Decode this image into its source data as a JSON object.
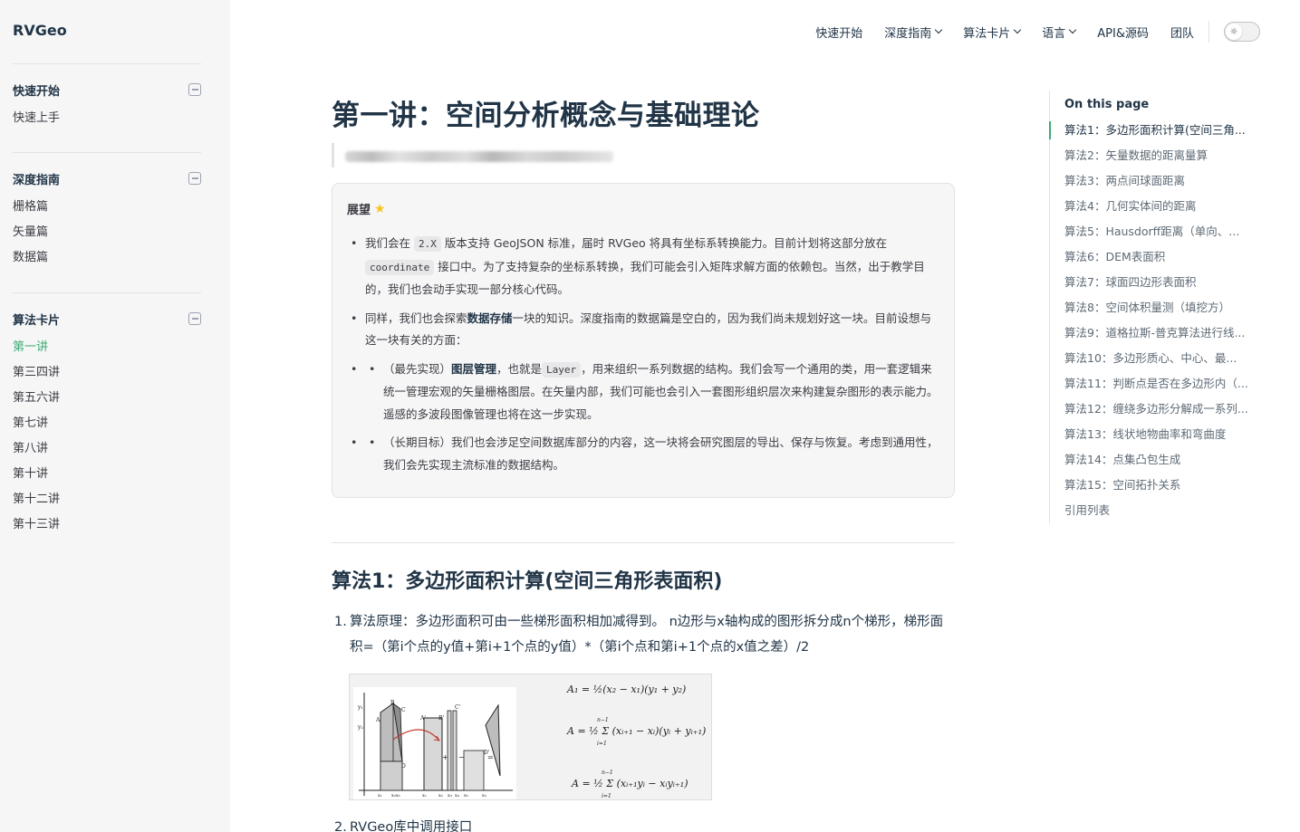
{
  "site": {
    "brand": "RVGeo"
  },
  "nav": {
    "items": [
      {
        "label": "快速开始",
        "dropdown": false
      },
      {
        "label": "深度指南",
        "dropdown": true
      },
      {
        "label": "算法卡片",
        "dropdown": true
      },
      {
        "label": "语言",
        "dropdown": true
      },
      {
        "label": "API&源码",
        "dropdown": false
      },
      {
        "label": "团队",
        "dropdown": false
      }
    ],
    "theme_toggle_icon": "sun-icon"
  },
  "sidebar": {
    "groups": [
      {
        "title": "快速开始",
        "items": [
          "快速上手"
        ]
      },
      {
        "title": "深度指南",
        "items": [
          "栅格篇",
          "矢量篇",
          "数据篇"
        ]
      },
      {
        "title": "算法卡片",
        "items": [
          "第一讲",
          "第三四讲",
          "第五六讲",
          "第七讲",
          "第八讲",
          "第十讲",
          "第十二讲",
          "第十三讲"
        ],
        "active": "第一讲"
      }
    ]
  },
  "page": {
    "title": "第一讲：空间分析概念与基础理论",
    "callout": {
      "title": "展望",
      "icon": "star-icon",
      "items": {
        "i1": {
          "a": "我们会在",
          "code1": "2.X",
          "b": "版本支持 GeoJSON 标准，届时 RVGeo 将具有坐标系转换能力。目前计划将这部分放在",
          "code2": "coordinate",
          "c": "接口中。为了支持复杂的坐标系转换，我们可能会引入矩阵求解方面的依赖包。当然，出于教学目的，我们也会动手实现一部分核心代码。"
        },
        "i2": {
          "a": "同样，我们也会探索",
          "strong": "数据存储",
          "b": "一块的知识。深度指南的数据篇是空白的，因为我们尚未规划好这一块。目前设想与这一块有关的方面："
        },
        "i3": {
          "a": "（最先实现）",
          "strong": "图层管理",
          "b": "，也就是",
          "code": "Layer",
          "c": "，用来组织一系列数据的结构。我们会写一个通用的类，用一套逻辑来统一管理宏观的矢量栅格图层。在矢量内部，我们可能也会引入一套图形组织层次来构建复杂图形的表示能力。遥感的多波段图像管理也将在这一步实现。"
        },
        "i4": {
          "a": "（长期目标）我们也会涉足空间数据库部分的内容，这一块将会研究图层的导出、保存与恢复。考虑到通用性，我们会先实现主流标准的数据结构。"
        }
      }
    },
    "section1": {
      "title": "算法1：多边形面积计算(空间三角形表面积)",
      "steps": [
        {
          "num": "1.",
          "text": "算法原理：多边形面积可由一些梯形面积相加减得到。 n边形与x轴构成的图形拆分成n个梯形，梯形面积=（第i个点的y值+第i+1个点的y值）*（第i个点和第i+1个点的x值之差）/2"
        },
        {
          "num": "2.",
          "text": "RVGeo库中调用接口"
        }
      ],
      "figure": {
        "formula1": "A₁ = ½(x₂ − x₁)(y₁ + y₂)",
        "formula2": "A = ½ Σ (xᵢ₊₁ − xᵢ)(yᵢ + yᵢ₊₁)",
        "formula3": "A = ½ Σ (xᵢ₊₁yᵢ − xᵢyᵢ₊₁)",
        "sum_upper": "n−1",
        "sum_lower": "i=1",
        "labels": [
          "y₁",
          "y₂",
          "A",
          "B",
          "C",
          "A'",
          "B'",
          "C'",
          "D",
          "D'",
          "+",
          "−",
          "=",
          "x₁",
          "x₂x₃",
          "x₁",
          "x₂",
          "x₃",
          "x₄",
          "x₅",
          "x₃"
        ]
      }
    }
  },
  "toc": {
    "title": "On this page",
    "items": [
      "算法1：多边形面积计算(空间三角...",
      "算法2：矢量数据的距离量算",
      "算法3：两点间球面距离",
      "算法4：几何实体间的距离",
      "算法5：Hausdorff距离（单向、...",
      "算法6：DEM表面积",
      "算法7：球面四边形表面积",
      "算法8：空间体积量测（填挖方）",
      "算法9：道格拉斯-普克算法进行线...",
      "算法10：多边形质心、中心、最...",
      "算法11：判断点是否在多边形内（...",
      "算法12：缠绕多边形分解成一系列...",
      "算法13：线状地物曲率和弯曲度",
      "算法14：点集凸包生成",
      "算法15：空间拓扑关系",
      "引用列表"
    ],
    "active_index": 0,
    "marker_color": "#3dab74"
  },
  "colors": {
    "accent": "#3dab74",
    "text": "#213547",
    "muted": "#3c3c43"
  }
}
